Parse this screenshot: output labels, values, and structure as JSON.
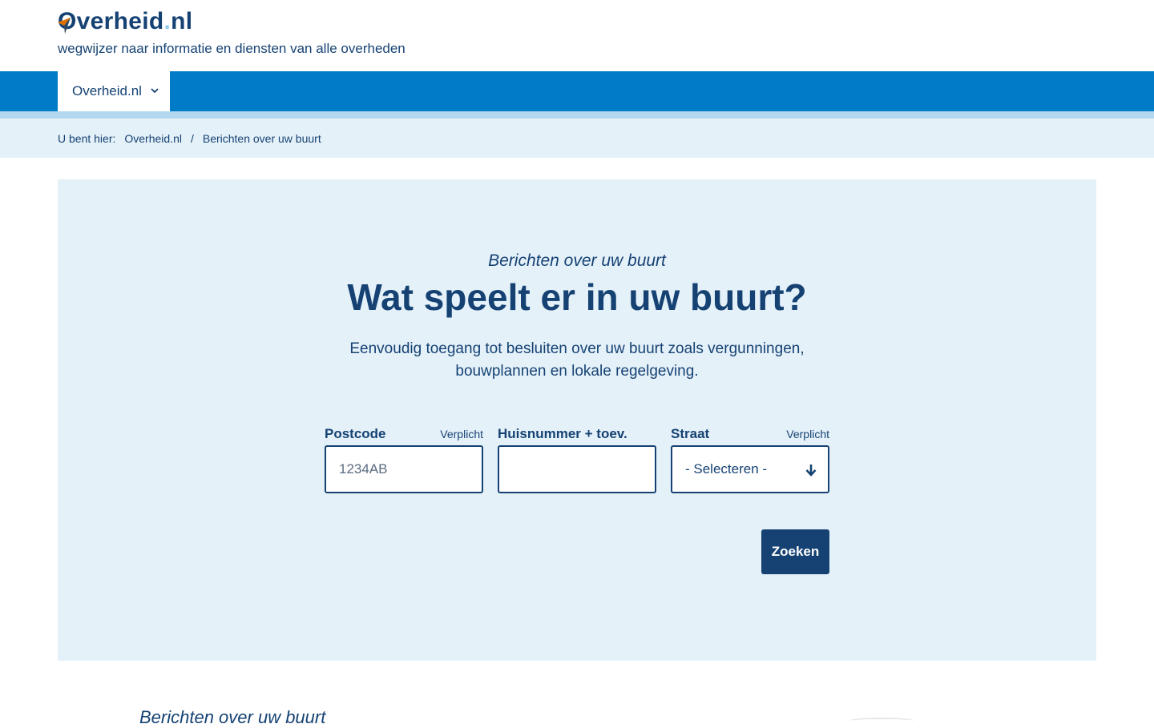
{
  "header": {
    "logo_text": "Overheid",
    "logo_dot": ".",
    "logo_suffix": "nl",
    "tagline": "wegwijzer naar informatie en diensten van alle overheden"
  },
  "nav": {
    "tab_label": "Overheid.nl"
  },
  "breadcrumb": {
    "label": "U bent hier:",
    "items": [
      "Overheid.nl",
      "Berichten over uw buurt"
    ],
    "separator": "/"
  },
  "hero": {
    "eyebrow": "Berichten over uw buurt",
    "title": "Wat speelt er in uw buurt?",
    "subtitle": "Eenvoudig toegang tot besluiten over uw buurt zoals vergunningen, bouwplannen en lokale regelgeving."
  },
  "form": {
    "postcode": {
      "label": "Postcode",
      "required": "Verplicht",
      "placeholder": "1234AB",
      "value": ""
    },
    "huisnummer": {
      "label": "Huisnummer + toev.",
      "value": ""
    },
    "straat": {
      "label": "Straat",
      "required": "Verplicht",
      "selected": "- Selecteren -"
    },
    "submit_label": "Zoeken"
  },
  "next_section": {
    "title": "Berichten over uw buurt"
  },
  "colors": {
    "primary": "#154273",
    "nav_blue": "#007bc7",
    "light_blue": "#e5f1f9",
    "accent_orange": "#e17000"
  },
  "icons": {
    "logo": "overheid-logo-icon",
    "nav_chevron": "chevron-down-icon",
    "select_arrow": "arrow-down-icon"
  }
}
